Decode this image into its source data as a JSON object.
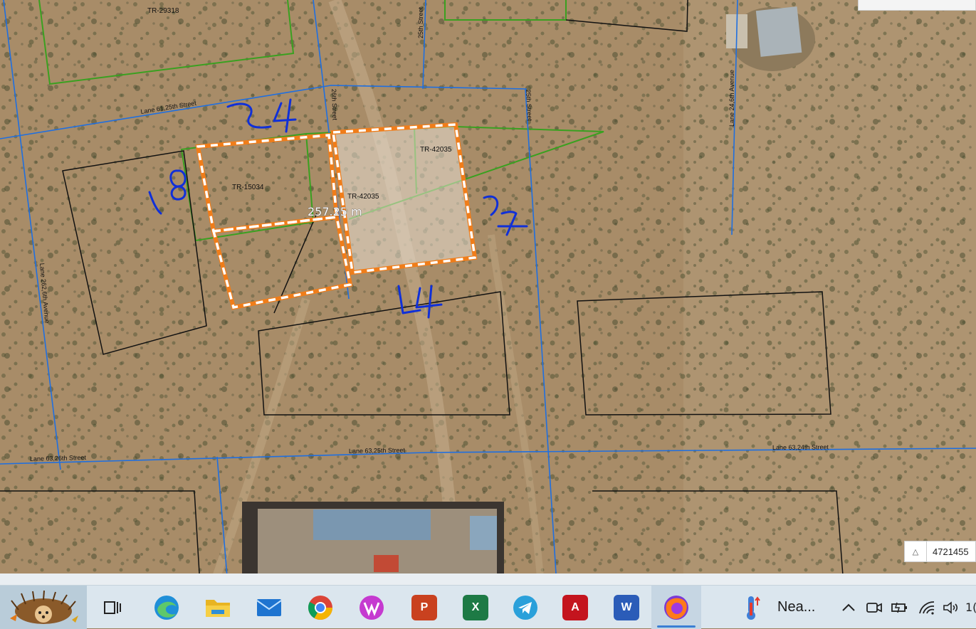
{
  "map": {
    "parcel_labels": {
      "tr_29318": "TR-29318",
      "tr_15034": "TR-15034",
      "tr_42035_a": "TR-42035",
      "tr_42035_b": "TR-42035"
    },
    "road_labels": {
      "lane61_25th": "Lane 61,25th Street",
      "street_26th": "26th Street",
      "street_25th_top": "25th Street",
      "street_25th_mid": "25th Street",
      "lane24_6th_ave": "Lane 24,6th Avenue",
      "lane262_6th_ave": "Lane 262,6th Avenue",
      "lane63_26th": "Lane 63,26th Street",
      "lane63_25th": "Lane 63,25th Street",
      "lane63_24th": "Lane 63,24th Street"
    },
    "measurement": "257.25 m",
    "handwritten": {
      "top": "24",
      "left": "18",
      "right": "27",
      "bottom": "24"
    },
    "coordinate_readout": "4721455",
    "colors": {
      "road_line": "#1f6fe0",
      "parcel_green": "#3aa020",
      "parcel_black": "#111111",
      "selection_orange": "#f07d1a",
      "handwriting": "#1030d8"
    }
  },
  "taskbar": {
    "start_icon": "hedgehog-avatar-icon",
    "apps": [
      {
        "name": "task-view-icon"
      },
      {
        "name": "edge-icon"
      },
      {
        "name": "file-explorer-icon"
      },
      {
        "name": "mail-icon"
      },
      {
        "name": "chrome-icon"
      },
      {
        "name": "wps-icon"
      },
      {
        "name": "powerpoint-icon",
        "glyph": "P"
      },
      {
        "name": "excel-icon",
        "glyph": "X"
      },
      {
        "name": "telegram-icon"
      },
      {
        "name": "autocad-icon",
        "glyph": "A"
      },
      {
        "name": "word-icon",
        "glyph": "W"
      },
      {
        "name": "firefox-icon"
      }
    ],
    "weather_text": "Nea...",
    "tray_clock_fragment": "1("
  }
}
